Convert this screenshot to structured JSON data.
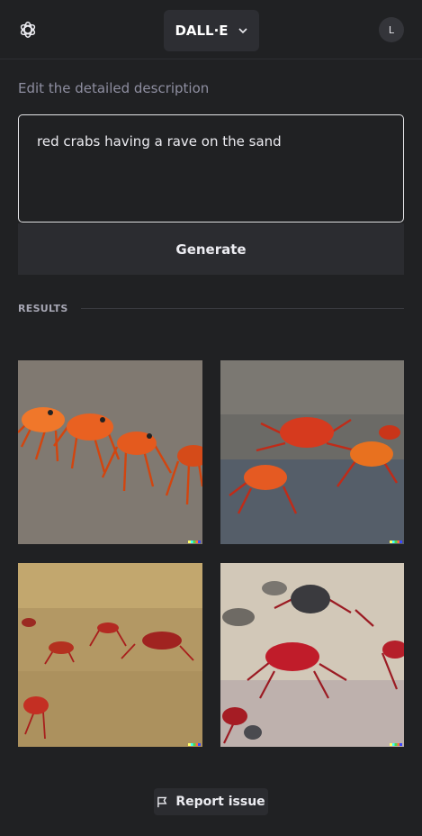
{
  "header": {
    "logo_icon": "openai-logo-icon",
    "model_label": "DALL·E",
    "model_dropdown_icon": "chevron-down-icon",
    "avatar_initial": "L"
  },
  "editor": {
    "label": "Edit the detailed description",
    "prompt_text": "red crabs having a rave on the sand",
    "generate_label": "Generate"
  },
  "results": {
    "label": "RESULTS",
    "images": [
      {
        "name": "result-image-1"
      },
      {
        "name": "result-image-2"
      },
      {
        "name": "result-image-3"
      },
      {
        "name": "result-image-4"
      }
    ]
  },
  "footer": {
    "report_label": "Report issue",
    "report_icon": "flag-icon"
  }
}
